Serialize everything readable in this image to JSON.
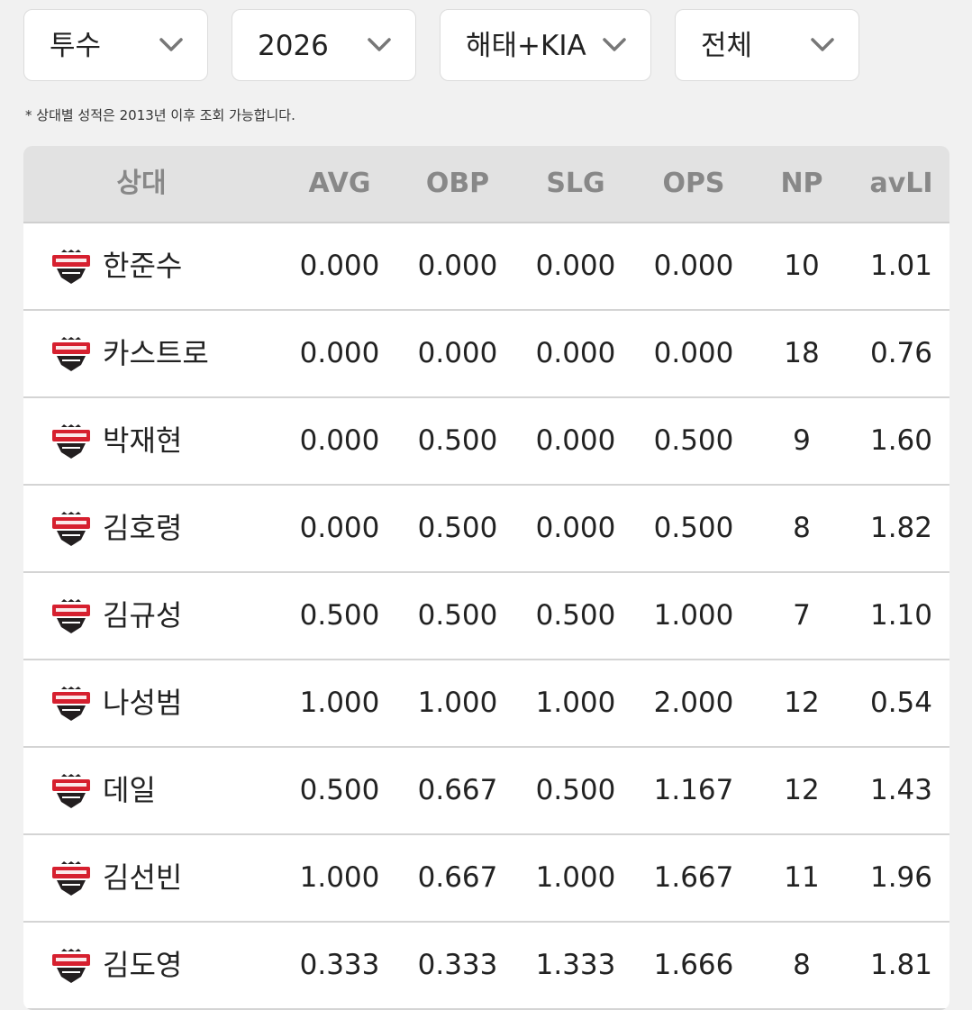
{
  "filters": [
    {
      "name": "position-filter",
      "value": "투수"
    },
    {
      "name": "year-filter",
      "value": "2026"
    },
    {
      "name": "team-filter",
      "value": "해태+KIA"
    },
    {
      "name": "split-filter",
      "value": "전체"
    }
  ],
  "note": "* 상대별 성적은 2013년 이후 조회 가능합니다.",
  "table": {
    "headers": {
      "opponent": "상대",
      "avg": "AVG",
      "obp": "OBP",
      "slg": "SLG",
      "ops": "OPS",
      "np": "NP",
      "avli": "avLI"
    },
    "logo_icon": "kia-tigers-logo-icon",
    "rows": [
      {
        "name": "한준수",
        "avg": "0.000",
        "obp": "0.000",
        "slg": "0.000",
        "ops": "0.000",
        "np": "10",
        "avli": "1.01"
      },
      {
        "name": "카스트로",
        "avg": "0.000",
        "obp": "0.000",
        "slg": "0.000",
        "ops": "0.000",
        "np": "18",
        "avli": "0.76"
      },
      {
        "name": "박재현",
        "avg": "0.000",
        "obp": "0.500",
        "slg": "0.000",
        "ops": "0.500",
        "np": "9",
        "avli": "1.60"
      },
      {
        "name": "김호령",
        "avg": "0.000",
        "obp": "0.500",
        "slg": "0.000",
        "ops": "0.500",
        "np": "8",
        "avli": "1.82"
      },
      {
        "name": "김규성",
        "avg": "0.500",
        "obp": "0.500",
        "slg": "0.500",
        "ops": "1.000",
        "np": "7",
        "avli": "1.10"
      },
      {
        "name": "나성범",
        "avg": "1.000",
        "obp": "1.000",
        "slg": "1.000",
        "ops": "2.000",
        "np": "12",
        "avli": "0.54"
      },
      {
        "name": "데일",
        "avg": "0.500",
        "obp": "0.667",
        "slg": "0.500",
        "ops": "1.167",
        "np": "12",
        "avli": "1.43"
      },
      {
        "name": "김선빈",
        "avg": "1.000",
        "obp": "0.667",
        "slg": "1.000",
        "ops": "1.667",
        "np": "11",
        "avli": "1.96"
      },
      {
        "name": "김도영",
        "avg": "0.333",
        "obp": "0.333",
        "slg": "1.333",
        "ops": "1.666",
        "np": "8",
        "avli": "1.81"
      }
    ]
  },
  "colors": {
    "header_bg": "#e2e2e2",
    "header_text": "#888888",
    "logo_red": "#d6202f",
    "logo_dark": "#231f20"
  }
}
